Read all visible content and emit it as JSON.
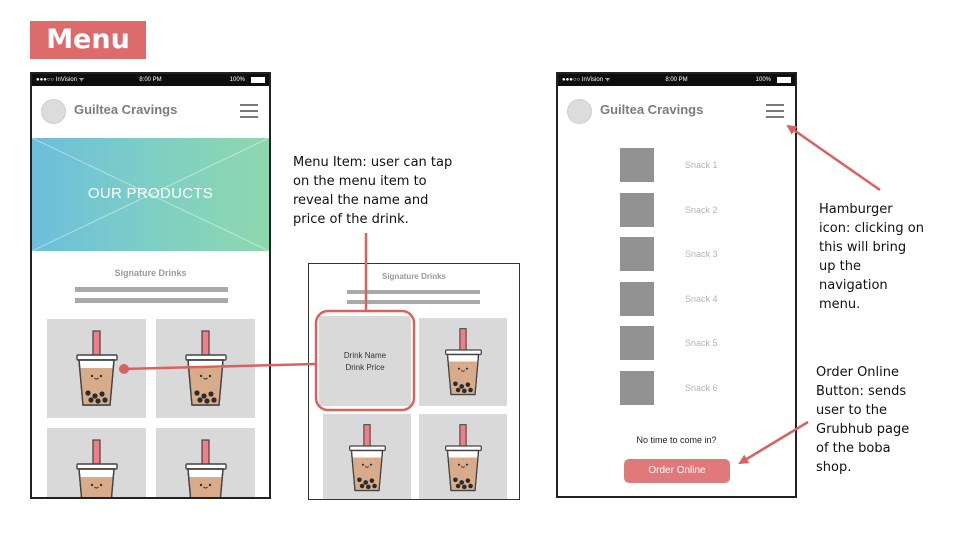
{
  "slide_title": "Menu",
  "status_bar": {
    "carrier": "●●●○○ InVision ᯤ",
    "time": "8:00 PM",
    "battery": "100%"
  },
  "app": {
    "name": "Guiltea Cravings"
  },
  "hero": {
    "text": "OUR PRODUCTS"
  },
  "menu": {
    "section_title": "Signature Drinks"
  },
  "detail": {
    "section_title": "Signature Drinks",
    "drink_name": "Drink Name",
    "drink_price": "Drink Price"
  },
  "snacks": [
    "Snack 1",
    "Snack 2",
    "Snack 3",
    "Snack 4",
    "Snack 5",
    "Snack 6"
  ],
  "order": {
    "prompt": "No time to come in?",
    "button_label": "Order Online"
  },
  "annotations": {
    "menu_item": [
      "Menu Item: user can tap",
      "on the menu item to",
      "reveal the name and",
      "price of the drink."
    ],
    "hamburger": [
      "Hamburger",
      "icon: clicking on",
      "this will bring",
      "up the",
      "navigation",
      "menu."
    ],
    "order_online": [
      "Order Online",
      "Button: sends",
      "user to the",
      "Grubhub page",
      "of the boba",
      "shop."
    ]
  },
  "colors": {
    "accent": "#dd6b6b",
    "button": "#e07a7a",
    "arrow": "#d9625f",
    "hero_start": "#6cbedc",
    "hero_end": "#8ed7ad"
  }
}
